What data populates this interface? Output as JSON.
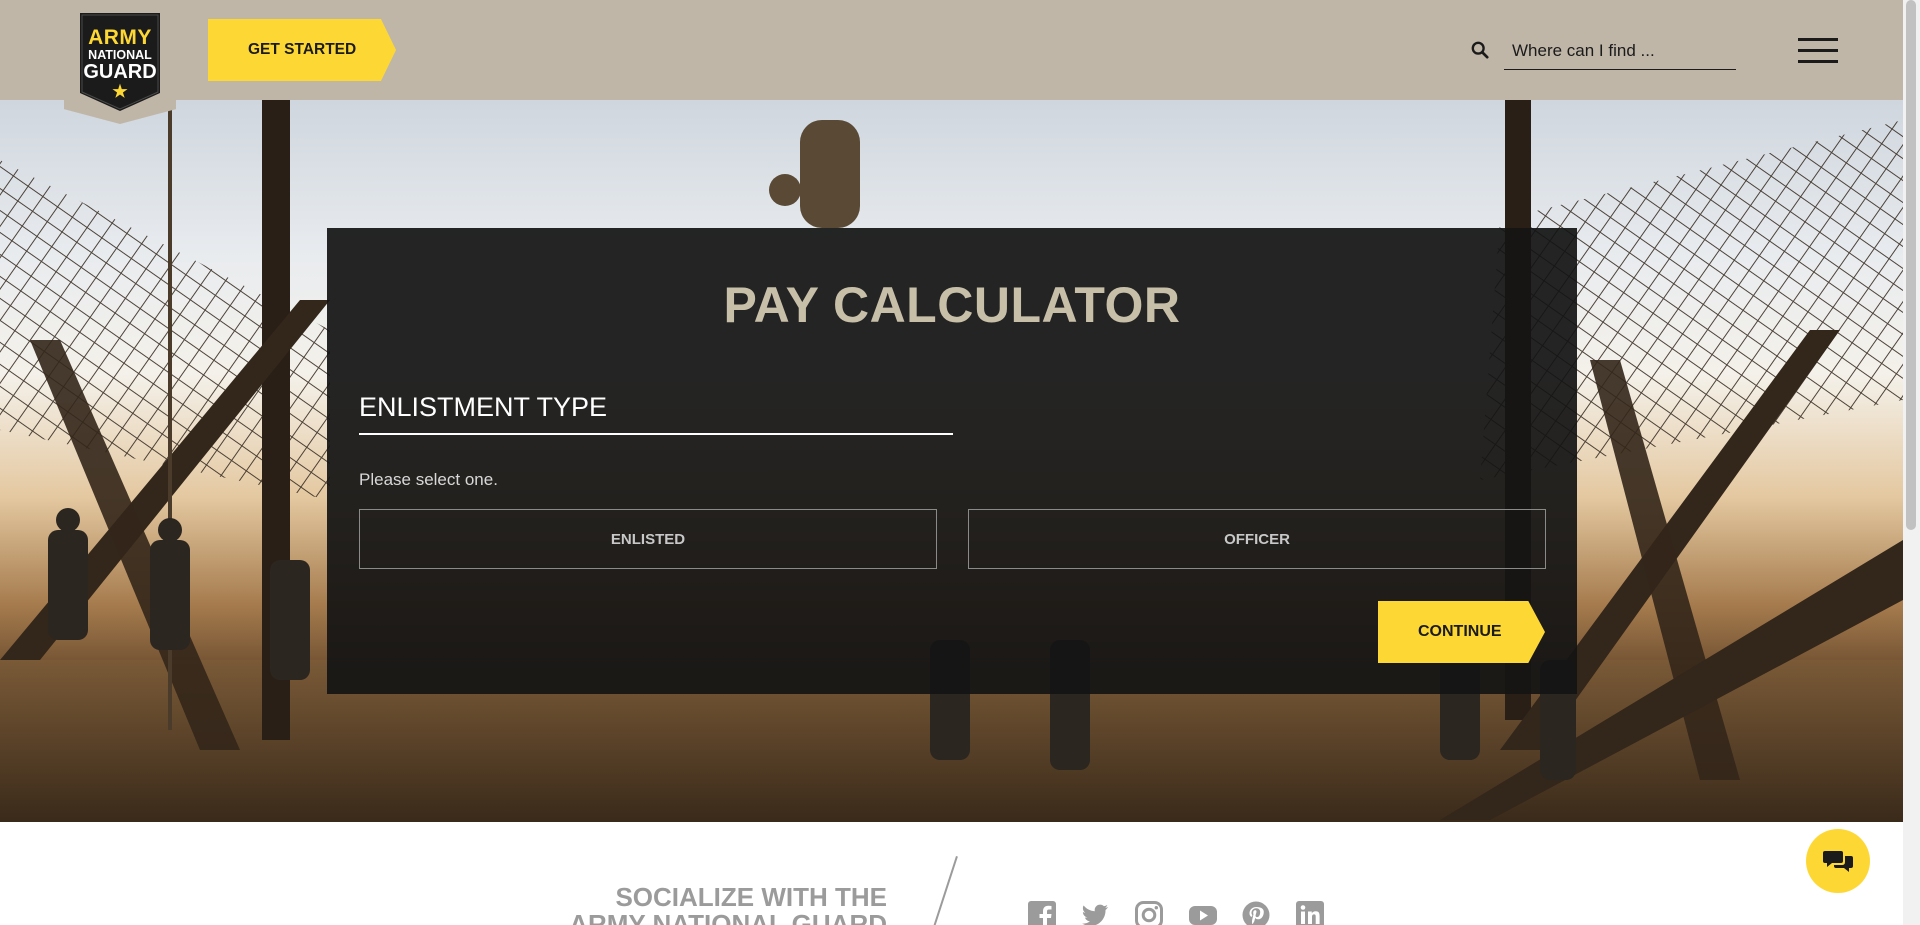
{
  "header": {
    "logo": {
      "line1": "ARMY",
      "line2": "NATIONAL",
      "line3": "GUARD",
      "star": "★"
    },
    "get_started_label": "GET STARTED",
    "search": {
      "placeholder": "Where can I find ..."
    },
    "icons": {
      "search": "search-icon",
      "menu": "hamburger-menu-icon"
    }
  },
  "calculator": {
    "title": "PAY CALCULATOR",
    "step_title": "ENLISTMENT TYPE",
    "instruction": "Please select one.",
    "options": [
      "ENLISTED",
      "OFFICER"
    ],
    "continue_label": "CONTINUE"
  },
  "footer": {
    "social_heading_line1": "SOCIALIZE WITH THE",
    "social_heading_line2": "ARMY NATIONAL GUARD",
    "social_icons": [
      "facebook-icon",
      "twitter-icon",
      "instagram-icon",
      "youtube-icon",
      "pinterest-icon",
      "linkedin-icon"
    ]
  },
  "chat": {
    "icon": "chat-bubbles-icon"
  },
  "colors": {
    "header_bg": "#bfb6a7",
    "accent_yellow": "#fdd835",
    "panel_bg": "#141414",
    "title_tan": "#c8bfa9"
  }
}
